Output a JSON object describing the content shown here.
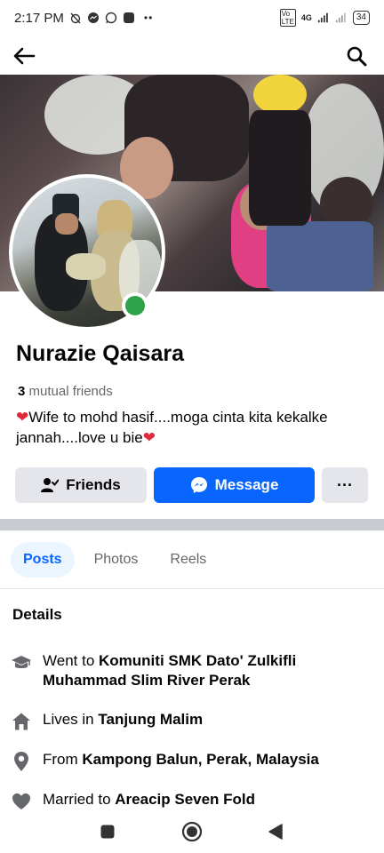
{
  "status_bar": {
    "time": "2:17 PM",
    "network": "4G",
    "battery": "34"
  },
  "profile": {
    "name": "Nurazie Qaisara",
    "mutual_count": "3",
    "mutual_label": "mutual friends",
    "bio_heart": "❤",
    "bio_text": "Wife to mohd hasif....moga cinta kita kekalke jannah....love u bie"
  },
  "actions": {
    "friends_label": "Friends",
    "message_label": "Message",
    "more_label": "···"
  },
  "tabs": [
    {
      "label": "Posts",
      "active": true
    },
    {
      "label": "Photos",
      "active": false
    },
    {
      "label": "Reels",
      "active": false
    }
  ],
  "details": {
    "title": "Details",
    "education_prefix": "Went to",
    "education_place": "Komuniti SMK Dato' Zulkifli Muhammad Slim River Perak",
    "lives_prefix": "Lives in",
    "lives_place": "Tanjung Malim",
    "from_prefix": "From",
    "from_place": "Kampong Balun, Perak, Malaysia",
    "married_prefix": "Married to",
    "married_name": "Areacip Seven Fold"
  },
  "colors": {
    "accent": "#0866ff",
    "online": "#31a24c",
    "secondary_button": "#e4e6eb"
  }
}
